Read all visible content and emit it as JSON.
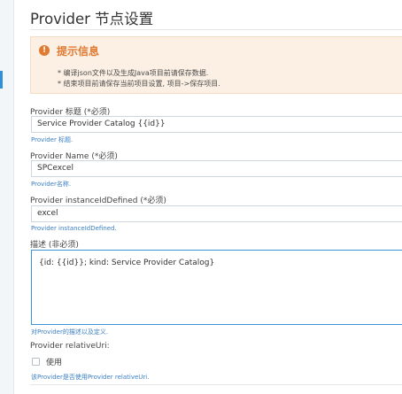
{
  "page": {
    "title": "Provider 节点设置"
  },
  "alert": {
    "icon": "info-icon",
    "title": "提示信息",
    "items": [
      "* 编译json文件以及生成Java项目前请保存数据.",
      "* 结束项目前请保存当前项目设置, 项目->保存项目."
    ]
  },
  "fields": {
    "title_field": {
      "label": "Provider 标题 (*必须)",
      "value": "Service Provider Catalog {{id}}",
      "help": "Provider 标题."
    },
    "name_field": {
      "label": "Provider Name (*必须)",
      "value": "SPCexcel",
      "help": "Provider名称."
    },
    "instance_field": {
      "label": "Provider instanceIdDefined (*必须)",
      "value": "excel",
      "help": "Provider instanceIdDefined."
    },
    "description_field": {
      "label": "描述 (非必须)",
      "value": "{id: {{id}}; kind: Service Provider Catalog}",
      "help": "对Provider的描述以及定义."
    },
    "relative_uri": {
      "label": "Provider relativeUri:",
      "checkbox_label": "使用",
      "checked": false,
      "help": "该Provider是否使用Provider relativeUri."
    }
  },
  "colors": {
    "accent": "#2f8fd8",
    "alert_bg": "#fcf0e4",
    "alert_accent": "#e17b33",
    "help_text": "#3a7fc4"
  }
}
